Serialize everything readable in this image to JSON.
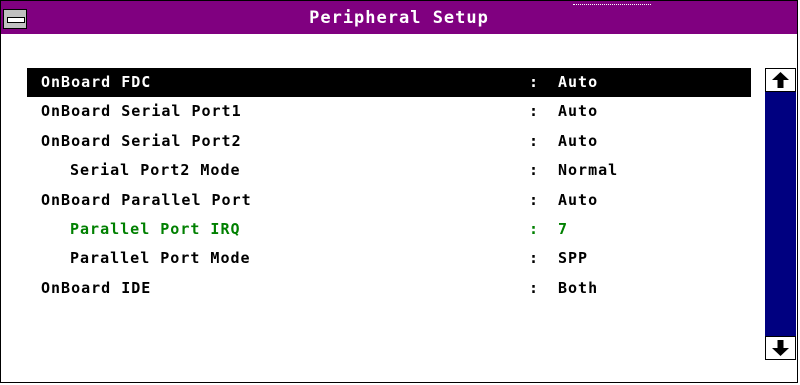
{
  "window": {
    "title": "Peripheral Setup"
  },
  "settings": [
    {
      "label": "OnBoard FDC",
      "colon": ":",
      "value": "Auto",
      "indent": false,
      "state": "selected"
    },
    {
      "label": "OnBoard Serial Port1",
      "colon": ":",
      "value": "Auto",
      "indent": false,
      "state": "normal"
    },
    {
      "label": "OnBoard Serial Port2",
      "colon": ":",
      "value": "Auto",
      "indent": false,
      "state": "normal"
    },
    {
      "label": "Serial Port2 Mode",
      "colon": ":",
      "value": "Normal",
      "indent": true,
      "state": "normal"
    },
    {
      "label": "OnBoard Parallel Port",
      "colon": ":",
      "value": "Auto",
      "indent": false,
      "state": "normal"
    },
    {
      "label": "Parallel Port IRQ",
      "colon": ":",
      "value": "7",
      "indent": true,
      "state": "active"
    },
    {
      "label": "Parallel Port Mode",
      "colon": ":",
      "value": "SPP",
      "indent": true,
      "state": "normal"
    },
    {
      "label": "OnBoard IDE",
      "colon": ":",
      "value": "Both",
      "indent": false,
      "state": "normal"
    }
  ],
  "scrollbar": {
    "up_icon": "arrow-up-icon",
    "down_icon": "arrow-down-icon"
  },
  "colors": {
    "title_bar": "#800080",
    "selected_row": "#000000",
    "active_row_text": "#008000",
    "scrollbar_track": "#000080"
  }
}
